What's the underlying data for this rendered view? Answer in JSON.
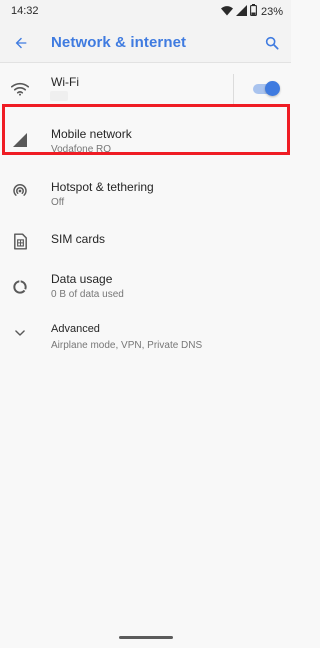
{
  "status_bar": {
    "time": "14:32",
    "battery_percent": "23%",
    "icons": [
      "wifi-icon",
      "signal-icon",
      "battery-icon"
    ]
  },
  "app_bar": {
    "title": "Network & internet",
    "back_icon": "arrow-back-icon",
    "search_icon": "search-icon"
  },
  "items": [
    {
      "id": "wifi",
      "title": "Wi-Fi",
      "summary": "",
      "icon": "wifi-icon",
      "toggle_on": true
    },
    {
      "id": "mobile-network",
      "title": "Mobile network",
      "summary": "Vodafone RO",
      "icon": "cell-signal-icon"
    },
    {
      "id": "hotspot",
      "title": "Hotspot & tethering",
      "summary": "Off",
      "icon": "hotspot-icon",
      "highlighted": true
    },
    {
      "id": "sim-cards",
      "title": "SIM cards",
      "summary": "",
      "icon": "sim-card-icon"
    },
    {
      "id": "data-usage",
      "title": "Data usage",
      "summary": "0 B of data used",
      "icon": "data-usage-icon"
    },
    {
      "id": "advanced",
      "title": "Advanced",
      "summary": "Airplane mode, VPN, Private DNS",
      "icon": "chevron-down-icon"
    }
  ],
  "colors": {
    "accent": "#3f7be0",
    "highlight": "#ef1c24",
    "background": "#f8f8f8"
  }
}
